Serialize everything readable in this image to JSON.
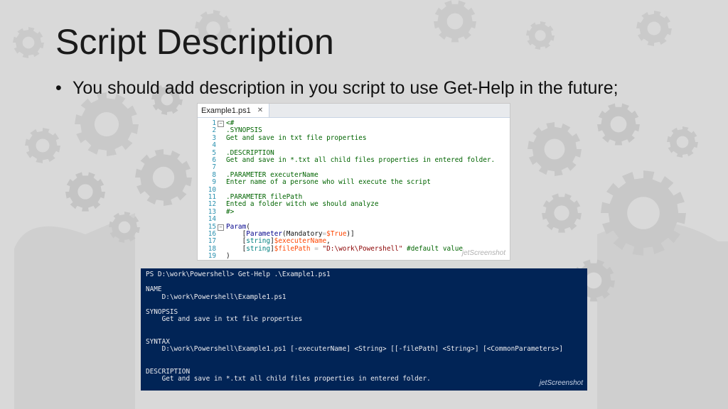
{
  "slide": {
    "title": "Script Description",
    "bullet": "You should add description in you script to use Get-Help in the future;",
    "bullet_symbol": "•"
  },
  "editor": {
    "tab_label": "Example1.ps1",
    "tab_close": "✕",
    "watermark": "jetScreenshot",
    "lines": [
      {
        "n": "1",
        "fold": "⊟",
        "parts": [
          {
            "t": "<#",
            "c": "c-comment"
          }
        ]
      },
      {
        "n": "2",
        "parts": [
          {
            "t": ".SYNOPSIS",
            "c": "c-comment"
          }
        ]
      },
      {
        "n": "3",
        "parts": [
          {
            "t": "Get and save in txt file properties",
            "c": "c-comment"
          }
        ]
      },
      {
        "n": "4",
        "parts": []
      },
      {
        "n": "5",
        "parts": [
          {
            "t": ".DESCRIPTION",
            "c": "c-comment"
          }
        ]
      },
      {
        "n": "6",
        "parts": [
          {
            "t": "Get and save in *.txt all child files properties in entered folder.",
            "c": "c-comment"
          }
        ]
      },
      {
        "n": "7",
        "parts": []
      },
      {
        "n": "8",
        "parts": [
          {
            "t": ".PARAMETER executerName",
            "c": "c-comment"
          }
        ]
      },
      {
        "n": "9",
        "parts": [
          {
            "t": "Enter name of a persone who will execute the script",
            "c": "c-comment"
          }
        ]
      },
      {
        "n": "10",
        "parts": []
      },
      {
        "n": "11",
        "parts": [
          {
            "t": ".PARAMETER filePath",
            "c": "c-comment"
          }
        ]
      },
      {
        "n": "12",
        "parts": [
          {
            "t": "Ented a folder witch we should analyze",
            "c": "c-comment"
          }
        ]
      },
      {
        "n": "13",
        "parts": [
          {
            "t": "#>",
            "c": "c-comment"
          }
        ]
      },
      {
        "n": "14",
        "parts": []
      },
      {
        "n": "15",
        "fold": "⊟",
        "parts": [
          {
            "t": "Param",
            "c": "c-keyword"
          },
          {
            "t": "(",
            "c": "c-plain"
          }
        ]
      },
      {
        "n": "16",
        "parts": [
          {
            "t": "    [",
            "c": "c-plain"
          },
          {
            "t": "Parameter",
            "c": "c-attr"
          },
          {
            "t": "(",
            "c": "c-plain"
          },
          {
            "t": "Mandatory",
            "c": "c-plain"
          },
          {
            "t": "=",
            "c": "c-op"
          },
          {
            "t": "$True",
            "c": "c-var"
          },
          {
            "t": ")]",
            "c": "c-plain"
          }
        ]
      },
      {
        "n": "17",
        "parts": [
          {
            "t": "    [",
            "c": "c-plain"
          },
          {
            "t": "string",
            "c": "c-type"
          },
          {
            "t": "]",
            "c": "c-plain"
          },
          {
            "t": "$executerName",
            "c": "c-var"
          },
          {
            "t": ",",
            "c": "c-plain"
          }
        ]
      },
      {
        "n": "18",
        "parts": [
          {
            "t": "    [",
            "c": "c-plain"
          },
          {
            "t": "string",
            "c": "c-type"
          },
          {
            "t": "]",
            "c": "c-plain"
          },
          {
            "t": "$filePath",
            "c": "c-var"
          },
          {
            "t": " = ",
            "c": "c-op"
          },
          {
            "t": "\"D:\\work\\Powershell\"",
            "c": "c-str"
          },
          {
            "t": " #default value",
            "c": "c-comment"
          }
        ]
      },
      {
        "n": "19",
        "parts": [
          {
            "t": ")",
            "c": "c-plain"
          }
        ]
      }
    ]
  },
  "console": {
    "watermark": "jetScreenshot",
    "lines": [
      "PS D:\\work\\Powershell> Get-Help .\\Example1.ps1",
      "",
      "NAME",
      "    D:\\work\\Powershell\\Example1.ps1",
      "",
      "SYNOPSIS",
      "    Get and save in txt file properties",
      "",
      "",
      "SYNTAX",
      "    D:\\work\\Powershell\\Example1.ps1 [-executerName] <String> [[-filePath] <String>] [<CommonParameters>]",
      "",
      "",
      "DESCRIPTION",
      "    Get and save in *.txt all child files properties in entered folder."
    ]
  },
  "colors": {
    "console_bg": "#012456",
    "console_fg": "#eeedf0",
    "comment": "#006400",
    "variable": "#ff4500",
    "string": "#8b0000"
  }
}
